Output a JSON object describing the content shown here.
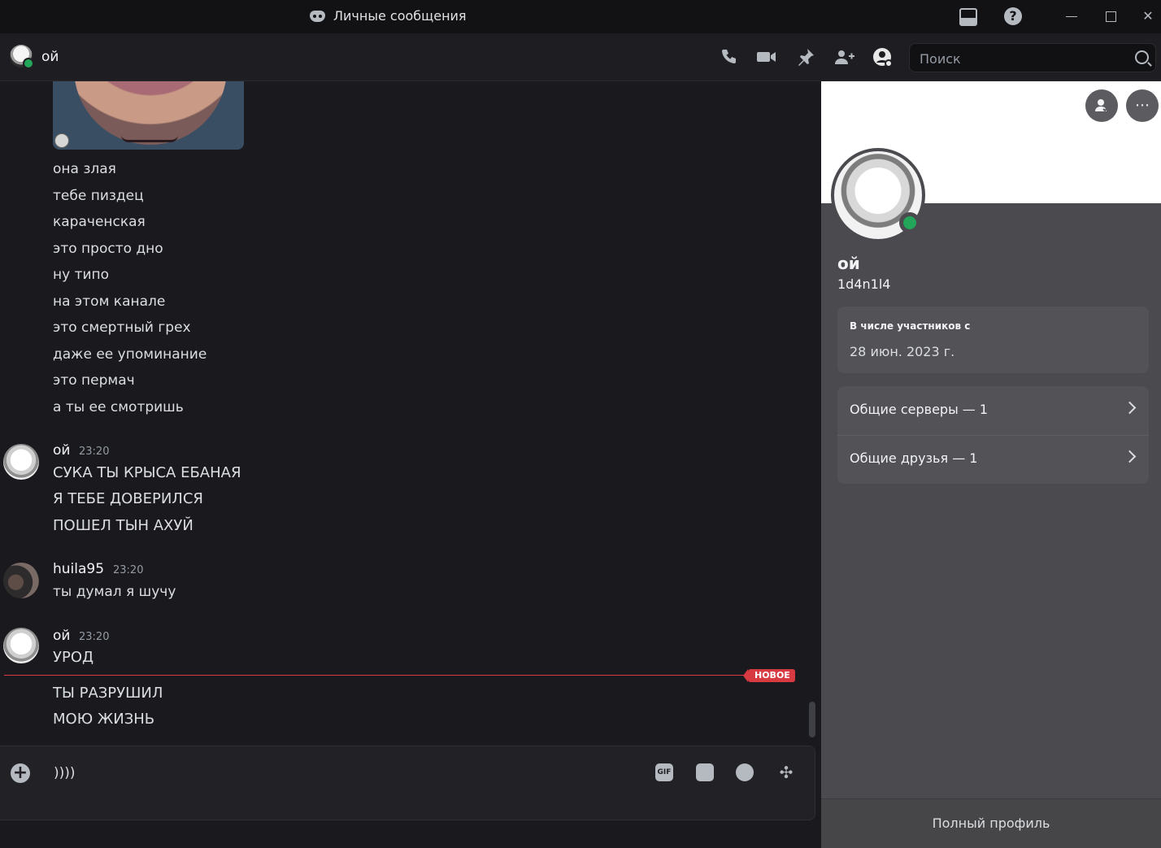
{
  "window": {
    "title": "Личные сообщения"
  },
  "header": {
    "name": "ой",
    "search_placeholder": "Поиск"
  },
  "chat": {
    "continued_lines": [
      "она злая",
      "тебе пиздец",
      "караченская",
      "это просто дно",
      "ну типо",
      "на этом канале",
      "это смертный грех",
      "даже ее упоминание",
      "это пермач",
      "а ты ее смотришь"
    ],
    "messages": [
      {
        "author": "ой",
        "time": "23:20",
        "lines": [
          "СУКА ТЫ КРЫСА ЕБАНАЯ",
          "Я ТЕБЕ ДОВЕРИЛСЯ",
          "ПОШЕЛ ТЫН АХУЙ"
        ]
      },
      {
        "author": "huila95",
        "time": "23:20",
        "lines": [
          "ты думал я шучу"
        ]
      },
      {
        "author": "ой",
        "time": "23:20",
        "lines": [
          "УРОД"
        ]
      }
    ],
    "new_badge": "НОВОЕ",
    "after_new_lines": [
      "ТЫ РАЗРУШИЛ",
      "МОЮ ЖИЗНЬ"
    ]
  },
  "composer": {
    "value": "))))",
    "gif_label": "GIF"
  },
  "profile": {
    "name": "ой",
    "tag": "1d4n1l4",
    "member_since_label": "В числе участников с",
    "member_since_value": "28 июн. 2023 г.",
    "mutual_servers": "Общие серверы — 1",
    "mutual_friends": "Общие друзья — 1",
    "full_profile": "Полный профиль"
  }
}
